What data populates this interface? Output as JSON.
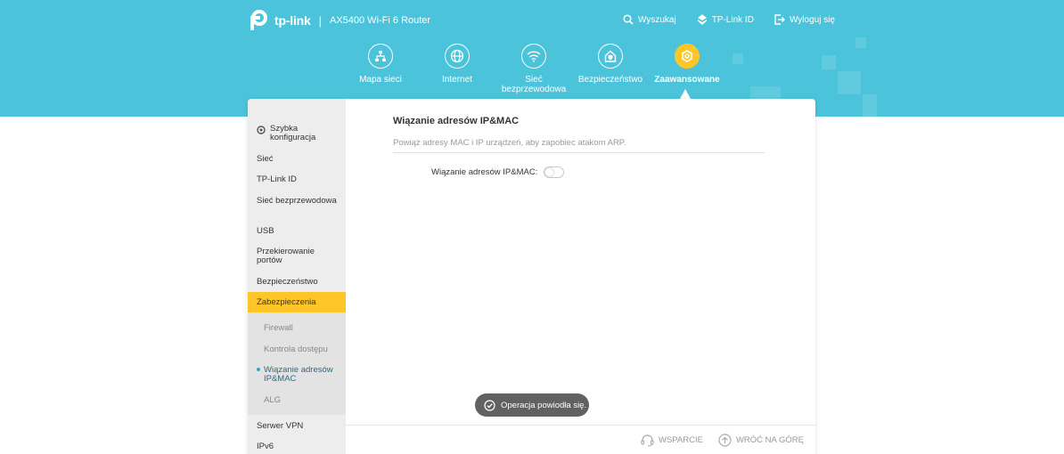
{
  "header": {
    "brand": "tp-link",
    "separator": "|",
    "model": "AX5400 Wi-Fi 6 Router",
    "links": [
      {
        "label": "Wyszukaj",
        "icon": "search-icon"
      },
      {
        "label": "TP-Link ID",
        "icon": "tplink-id-icon"
      },
      {
        "label": "Wyloguj się",
        "icon": "logout-icon"
      }
    ]
  },
  "nav": {
    "items": [
      {
        "label": "Mapa sieci",
        "icon": "network-map-icon"
      },
      {
        "label": "Internet",
        "icon": "globe-icon"
      },
      {
        "label": "Sieć bezprzewodowa",
        "icon": "wifi-icon"
      },
      {
        "label": "Bezpieczeństwo",
        "icon": "home-shield-icon"
      },
      {
        "label": "Zaawansowane",
        "icon": "gear-icon"
      }
    ],
    "active": "Zaawansowane"
  },
  "sidebar": {
    "items": [
      {
        "label": "Szybka konfiguracja",
        "icon": "quick-setup-icon"
      },
      {
        "label": "Sieć"
      },
      {
        "label": "TP-Link ID"
      },
      {
        "label": "Sieć bezprzewodowa"
      },
      {
        "label": "USB"
      },
      {
        "label": "Przekierowanie portów"
      },
      {
        "label": "Bezpieczeństwo"
      },
      {
        "label": "Zabezpieczenia"
      },
      {
        "label": "Serwer VPN"
      },
      {
        "label": "IPv6"
      }
    ],
    "active": "Zabezpieczenia",
    "subitems": [
      {
        "label": "Firewall"
      },
      {
        "label": "Kontrola dostępu"
      },
      {
        "label": "Wiązanie adresów IP&MAC"
      },
      {
        "label": "ALG"
      }
    ],
    "current_subitem": "Wiązanie adresów IP&MAC"
  },
  "main": {
    "title": "Wiązanie adresów IP&MAC",
    "subtitle": "Powiąż adresy MAC i IP urządzeń, aby zapobiec atakom ARP.",
    "toggle_label": "Wiązanie adresów IP&MAC:",
    "toggle_on": false
  },
  "toast": {
    "message": "Operacja powiodła się.",
    "icon": "check-circle-icon"
  },
  "footer": {
    "support_label": "WSPARCIE",
    "support_icon": "headset-icon",
    "top_label": "WRÓĆ NA GÓRĘ",
    "top_icon": "arrow-up-circle-icon"
  },
  "colors": {
    "header_bg": "#4bc4db",
    "accent": "#ffc629",
    "sidebar_bg": "#ededed",
    "toast_bg": "#616161"
  }
}
